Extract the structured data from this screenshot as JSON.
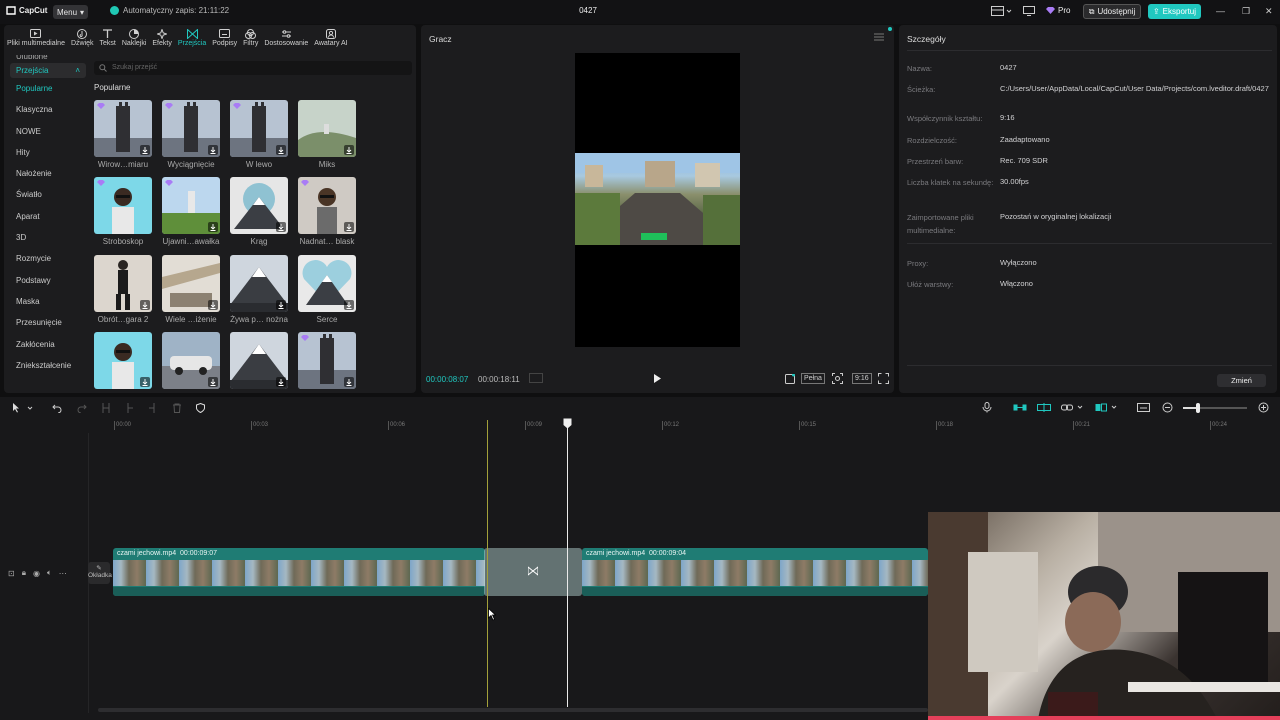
{
  "app": {
    "logo": "CapCut",
    "menu_label": "Menu",
    "autosave": "Automatyczny zapis: 21:11:22",
    "project_title": "0427",
    "pro_label": "Pro",
    "share_label": "Udostępnij",
    "export_label": "Eksportuj"
  },
  "tabs": [
    {
      "label": "Pliki multimedialne",
      "icon": "media-icon"
    },
    {
      "label": "Dźwięk",
      "icon": "audio-icon"
    },
    {
      "label": "Tekst",
      "icon": "text-icon"
    },
    {
      "label": "Naklejki",
      "icon": "sticker-icon"
    },
    {
      "label": "Efekty",
      "icon": "effects-icon"
    },
    {
      "label": "Przejścia",
      "icon": "transitions-icon"
    },
    {
      "label": "Podpisy",
      "icon": "captions-icon"
    },
    {
      "label": "Filtry",
      "icon": "filters-icon"
    },
    {
      "label": "Dostosowanie",
      "icon": "adjust-icon"
    },
    {
      "label": "Awatary AI",
      "icon": "avatar-icon"
    }
  ],
  "sidebar": {
    "cut_item": "Ulubione",
    "header": "Przejścia",
    "items": [
      "Popularne",
      "Klasyczna",
      "NOWE",
      "Hity",
      "Nałożenie",
      "Światło",
      "Aparat",
      "3D",
      "Rozmycie",
      "Podstawy",
      "Maska",
      "Przesunięcie",
      "Zakłócenia",
      "Zniekształcenie"
    ]
  },
  "search": {
    "placeholder": "Szukaj przejść"
  },
  "grid": {
    "title": "Popularne",
    "tiles": [
      {
        "label": "Wirow…miaru",
        "crown": true,
        "download": true,
        "style": "tower"
      },
      {
        "label": "Wyciągnięcie",
        "crown": true,
        "download": true,
        "style": "tower"
      },
      {
        "label": "W lewo",
        "crown": true,
        "download": true,
        "style": "tower"
      },
      {
        "label": "Miks",
        "crown": false,
        "download": true,
        "style": "hill"
      },
      {
        "label": "Stroboskop",
        "crown": true,
        "download": false,
        "style": "person-blue"
      },
      {
        "label": "Ujawni…awałka",
        "crown": true,
        "download": true,
        "style": "field"
      },
      {
        "label": "Krąg",
        "crown": false,
        "download": true,
        "style": "mountain-circle"
      },
      {
        "label": "Nadnat… blask",
        "crown": true,
        "download": true,
        "style": "person-grey"
      },
      {
        "label": "Obrót…gara 2",
        "crown": false,
        "download": true,
        "style": "person-standing"
      },
      {
        "label": "Wiele …iżenie",
        "crown": false,
        "download": true,
        "style": "building"
      },
      {
        "label": "Żywa p… nożna",
        "crown": false,
        "download": true,
        "style": "mountain"
      },
      {
        "label": "Serce",
        "crown": false,
        "download": true,
        "style": "mountain-heart"
      },
      {
        "label": "",
        "crown": false,
        "download": true,
        "style": "person-blue"
      },
      {
        "label": "",
        "crown": false,
        "download": true,
        "style": "car"
      },
      {
        "label": "",
        "crown": false,
        "download": true,
        "style": "mountain"
      },
      {
        "label": "",
        "crown": true,
        "download": true,
        "style": "tower"
      }
    ]
  },
  "player": {
    "title": "Gracz",
    "current_time": "00:00:08:07",
    "total_time": "00:00:18:11",
    "full_label": "Pełna",
    "ratio_label": "9:16"
  },
  "details": {
    "title": "Szczegóły",
    "rows": [
      {
        "key": "Nazwa:",
        "value": "0427"
      },
      {
        "key": "Ścieżka:",
        "value": "C:/Users/User/AppData/Local/CapCut/User Data/Projects/com.lveditor.draft/0427"
      },
      {
        "key": "Współczynnik kształtu:",
        "value": "9:16"
      },
      {
        "key": "Rozdzielczość:",
        "value": "Zaadaptowano"
      },
      {
        "key": "Przestrzeń barw:",
        "value": "Rec. 709 SDR"
      },
      {
        "key": "Liczba klatek na sekundę:",
        "value": "30.00fps"
      },
      {
        "key": "Zaimportowane pliki multimedialne:",
        "value": "Pozostań w oryginalnej lokalizacji"
      },
      {
        "key": "Proxy:",
        "value": "Wyłączono"
      },
      {
        "key": "Ułóż warstwy:",
        "value": "Włączono"
      }
    ],
    "change_label": "Zmień"
  },
  "timeline": {
    "ruler": [
      "00:00",
      "00:03",
      "00:06",
      "00:09",
      "00:12",
      "00:15",
      "00:18",
      "00:21",
      "00:24"
    ],
    "cover_label": "Okładka",
    "clips": [
      {
        "name": "czami jechowi.mp4",
        "duration": "00:00:09:07"
      },
      {
        "name": "czami jechowi.mp4",
        "duration": "00:00:09:04"
      }
    ]
  },
  "colors": {
    "accent": "#20c8c0",
    "clip": "#1f7c74",
    "panel": "#1c1c1e",
    "background": "#0f0f10"
  }
}
